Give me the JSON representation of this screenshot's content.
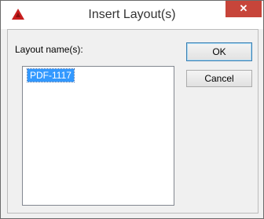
{
  "window": {
    "title": "Insert Layout(s)",
    "close_glyph": "✕",
    "app_icon": "autocad-logo-icon"
  },
  "form": {
    "label": "Layout name(s):",
    "layouts": [
      "PDF-1117"
    ],
    "selected_index": 0
  },
  "buttons": {
    "ok": "OK",
    "cancel": "Cancel"
  },
  "colors": {
    "selection": "#3399ff",
    "close": "#c7453a",
    "icon_red": "#c81e1e"
  }
}
